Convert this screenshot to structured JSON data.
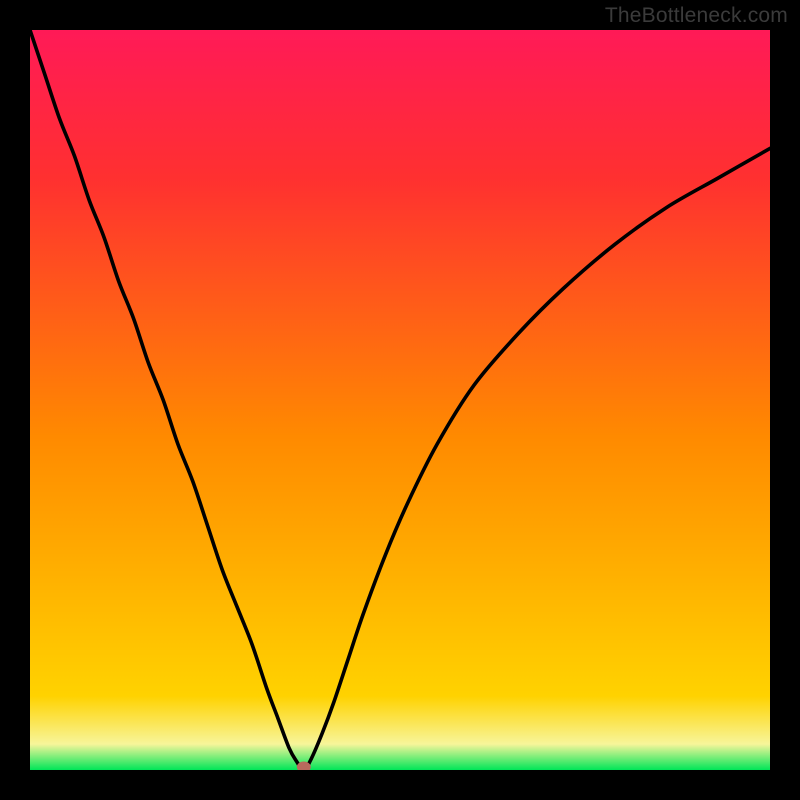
{
  "watermark": "TheBottleneck.com",
  "chart_data": {
    "type": "line",
    "title": "",
    "xlabel": "",
    "ylabel": "",
    "xlim": [
      0,
      100
    ],
    "ylim": [
      0,
      100
    ],
    "background_gradient": [
      "#00e658",
      "#f7f59a",
      "#ffd200",
      "#ff8a00",
      "#ff3030",
      "#ff1a57"
    ],
    "marker": {
      "x": 37,
      "y": 0,
      "color": "#b86a5d"
    },
    "series": [
      {
        "name": "curve",
        "x": [
          0,
          2,
          4,
          6,
          8,
          10,
          12,
          14,
          16,
          18,
          20,
          22,
          24,
          26,
          28,
          30,
          32,
          33.5,
          35,
          36,
          37,
          38,
          39.5,
          41,
          43,
          45,
          48,
          51,
          55,
          60,
          66,
          72,
          79,
          86,
          93,
          100
        ],
        "values": [
          100,
          94,
          88,
          83,
          77,
          72,
          66,
          61,
          55,
          50,
          44,
          39,
          33,
          27,
          22,
          17,
          11,
          7,
          3,
          1.2,
          0,
          1.5,
          5,
          9,
          15,
          21,
          29,
          36,
          44,
          52,
          59,
          65,
          71,
          76,
          80,
          84
        ]
      }
    ]
  }
}
